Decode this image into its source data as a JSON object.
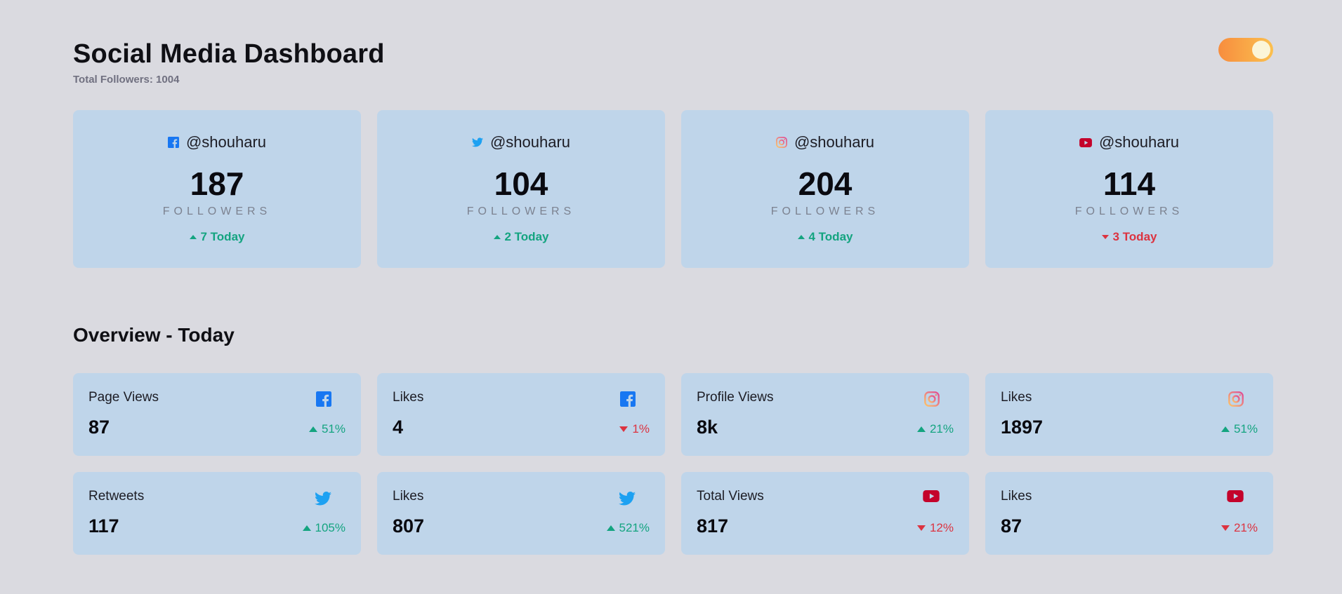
{
  "header": {
    "title": "Social Media Dashboard",
    "subtitle": "Total Followers: 1004",
    "toggle_state": "on"
  },
  "colors": {
    "background": "#dadae0",
    "card": "#bfd5ea",
    "up": "#14a480",
    "down": "#dc3340",
    "facebook": "#1877f2",
    "twitter": "#1da1f2",
    "youtube": "#c4032b",
    "instagram_gradient": [
      "#fdc468",
      "#df4996"
    ]
  },
  "followers": [
    {
      "platform": "facebook",
      "icon": "facebook-icon",
      "handle": "@shouharu",
      "count": "187",
      "unit": "FOLLOWERS",
      "change": "7 Today",
      "trend": "up"
    },
    {
      "platform": "twitter",
      "icon": "twitter-icon",
      "handle": "@shouharu",
      "count": "104",
      "unit": "FOLLOWERS",
      "change": "2 Today",
      "trend": "up"
    },
    {
      "platform": "instagram",
      "icon": "instagram-icon",
      "handle": "@shouharu",
      "count": "204",
      "unit": "FOLLOWERS",
      "change": "4 Today",
      "trend": "up"
    },
    {
      "platform": "youtube",
      "icon": "youtube-icon",
      "handle": "@shouharu",
      "count": "114",
      "unit": "FOLLOWERS",
      "change": "3 Today",
      "trend": "down"
    }
  ],
  "overview": {
    "title": "Overview - Today",
    "cards": [
      {
        "metric": "Page Views",
        "platform": "facebook",
        "icon": "facebook-icon",
        "value": "87",
        "percent": "51%",
        "trend": "up"
      },
      {
        "metric": "Likes",
        "platform": "facebook",
        "icon": "facebook-icon",
        "value": "4",
        "percent": "1%",
        "trend": "down"
      },
      {
        "metric": "Profile Views",
        "platform": "instagram",
        "icon": "instagram-icon",
        "value": "8k",
        "percent": "21%",
        "trend": "up"
      },
      {
        "metric": "Likes",
        "platform": "instagram",
        "icon": "instagram-icon",
        "value": "1897",
        "percent": "51%",
        "trend": "up"
      },
      {
        "metric": "Retweets",
        "platform": "twitter",
        "icon": "twitter-icon",
        "value": "117",
        "percent": "105%",
        "trend": "up"
      },
      {
        "metric": "Likes",
        "platform": "twitter",
        "icon": "twitter-icon",
        "value": "807",
        "percent": "521%",
        "trend": "up"
      },
      {
        "metric": "Total Views",
        "platform": "youtube",
        "icon": "youtube-icon",
        "value": "817",
        "percent": "12%",
        "trend": "down"
      },
      {
        "metric": "Likes",
        "platform": "youtube",
        "icon": "youtube-icon",
        "value": "87",
        "percent": "21%",
        "trend": "down"
      }
    ]
  }
}
